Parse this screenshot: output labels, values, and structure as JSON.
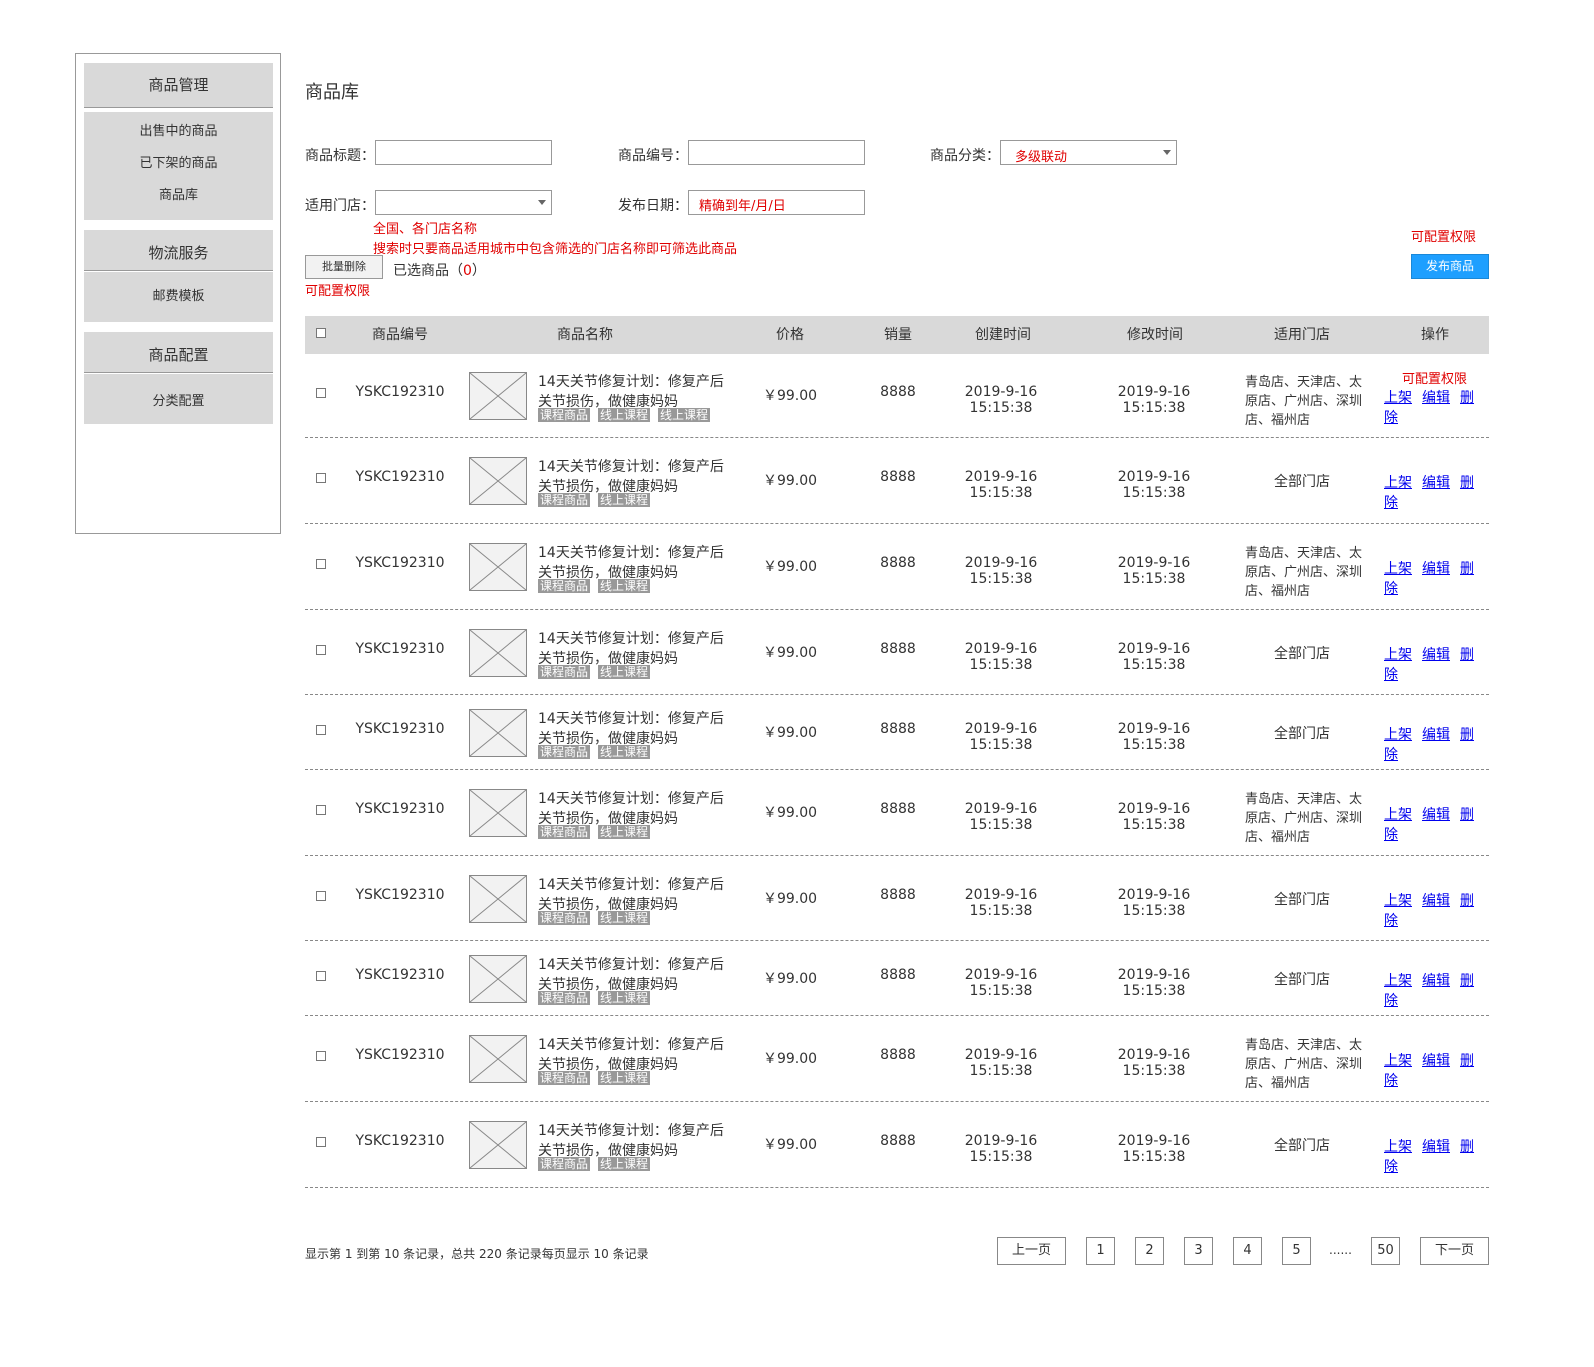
{
  "sidebar": {
    "sections": [
      {
        "title": "商品管理",
        "items": [
          "出售中的商品",
          "已下架的商品",
          "商品库"
        ]
      },
      {
        "title": "物流服务",
        "items": [
          "邮费模板"
        ]
      },
      {
        "title": "商品配置",
        "items": [
          "分类配置"
        ]
      }
    ]
  },
  "page_title": "商品库",
  "filters": {
    "title_label": "商品标题：",
    "code_label": "商品编号：",
    "category_label": "商品分类：",
    "category_value": "多级联动",
    "store_label": "适用门店：",
    "date_label": "发布日期：",
    "date_value": "精确到年/月/日",
    "store_note_1": "全国、各门店名称",
    "store_note_2": "搜索时只要商品适用城市中包含筛选的门店名称即可筛选此商品"
  },
  "actions": {
    "batch_delete": "批量删除",
    "selected_prefix": "已选商品（",
    "selected_count": "0",
    "selected_suffix": "）",
    "perm_note": "可配置权限",
    "publish": "发布商品",
    "publish_perm_note": "可配置权限"
  },
  "table": {
    "headers": [
      "商品编号",
      "商品名称",
      "价格",
      "销量",
      "创建时间",
      "修改时间",
      "适用门店",
      "操作"
    ],
    "ops_perm_note": "可配置权限",
    "rows": [
      {
        "code": "YSKC192310",
        "name1": "14天关节修复计划：修复产后",
        "name2": "关节损伤，做健康妈妈",
        "tags": [
          "课程商品",
          "线上课程",
          "线上课程"
        ],
        "price": "￥99.00",
        "sales": "8888",
        "created": "2019-9-16 15:15:38",
        "modified": "2019-9-16 15:15:38",
        "store": "青岛店、天津店、太原店、广州店、深圳店、福州店",
        "multi": true,
        "ops": [
          "上架",
          "编辑",
          "删除"
        ]
      },
      {
        "code": "YSKC192310",
        "name1": "14天关节修复计划：修复产后",
        "name2": "关节损伤，做健康妈妈",
        "tags": [
          "课程商品",
          "线上课程"
        ],
        "price": "￥99.00",
        "sales": "8888",
        "created": "2019-9-16 15:15:38",
        "modified": "2019-9-16 15:15:38",
        "store": "全部门店",
        "multi": false,
        "ops": [
          "上架",
          "编辑",
          "删除"
        ]
      },
      {
        "code": "YSKC192310",
        "name1": "14天关节修复计划：修复产后",
        "name2": "关节损伤，做健康妈妈",
        "tags": [
          "课程商品",
          "线上课程"
        ],
        "price": "￥99.00",
        "sales": "8888",
        "created": "2019-9-16 15:15:38",
        "modified": "2019-9-16 15:15:38",
        "store": "青岛店、天津店、太原店、广州店、深圳店、福州店",
        "multi": true,
        "ops": [
          "上架",
          "编辑",
          "删除"
        ]
      },
      {
        "code": "YSKC192310",
        "name1": "14天关节修复计划：修复产后",
        "name2": "关节损伤，做健康妈妈",
        "tags": [
          "课程商品",
          "线上课程"
        ],
        "price": "￥99.00",
        "sales": "8888",
        "created": "2019-9-16 15:15:38",
        "modified": "2019-9-16 15:15:38",
        "store": "全部门店",
        "multi": false,
        "ops": [
          "上架",
          "编辑",
          "删除"
        ]
      },
      {
        "code": "YSKC192310",
        "name1": "14天关节修复计划：修复产后",
        "name2": "关节损伤，做健康妈妈",
        "tags": [
          "课程商品",
          "线上课程"
        ],
        "price": "￥99.00",
        "sales": "8888",
        "created": "2019-9-16 15:15:38",
        "modified": "2019-9-16 15:15:38",
        "store": "全部门店",
        "multi": false,
        "ops": [
          "上架",
          "编辑",
          "删除"
        ]
      },
      {
        "code": "YSKC192310",
        "name1": "14天关节修复计划：修复产后",
        "name2": "关节损伤，做健康妈妈",
        "tags": [
          "课程商品",
          "线上课程"
        ],
        "price": "￥99.00",
        "sales": "8888",
        "created": "2019-9-16 15:15:38",
        "modified": "2019-9-16 15:15:38",
        "store": "青岛店、天津店、太原店、广州店、深圳店、福州店",
        "multi": true,
        "ops": [
          "上架",
          "编辑",
          "删除"
        ]
      },
      {
        "code": "YSKC192310",
        "name1": "14天关节修复计划：修复产后",
        "name2": "关节损伤，做健康妈妈",
        "tags": [
          "课程商品",
          "线上课程"
        ],
        "price": "￥99.00",
        "sales": "8888",
        "created": "2019-9-16 15:15:38",
        "modified": "2019-9-16 15:15:38",
        "store": "全部门店",
        "multi": false,
        "ops": [
          "上架",
          "编辑",
          "删除"
        ]
      },
      {
        "code": "YSKC192310",
        "name1": "14天关节修复计划：修复产后",
        "name2": "关节损伤，做健康妈妈",
        "tags": [
          "课程商品",
          "线上课程"
        ],
        "price": "￥99.00",
        "sales": "8888",
        "created": "2019-9-16 15:15:38",
        "modified": "2019-9-16 15:15:38",
        "store": "全部门店",
        "multi": false,
        "ops": [
          "上架",
          "编辑",
          "删除"
        ]
      },
      {
        "code": "YSKC192310",
        "name1": "14天关节修复计划：修复产后",
        "name2": "关节损伤，做健康妈妈",
        "tags": [
          "课程商品",
          "线上课程"
        ],
        "price": "￥99.00",
        "sales": "8888",
        "created": "2019-9-16 15:15:38",
        "modified": "2019-9-16 15:15:38",
        "store": "青岛店、天津店、太原店、广州店、深圳店、福州店",
        "multi": true,
        "ops": [
          "上架",
          "编辑",
          "删除"
        ]
      },
      {
        "code": "YSKC192310",
        "name1": "14天关节修复计划：修复产后",
        "name2": "关节损伤，做健康妈妈",
        "tags": [
          "课程商品",
          "线上课程"
        ],
        "price": "￥99.00",
        "sales": "8888",
        "created": "2019-9-16 15:15:38",
        "modified": "2019-9-16 15:15:38",
        "store": "全部门店",
        "multi": false,
        "ops": [
          "上架",
          "编辑",
          "删除"
        ]
      }
    ]
  },
  "pagination": {
    "summary": "显示第 1 到第 10 条记录，总共 220 条记录每页显示 10  条记录",
    "prev": "上一页",
    "pages": [
      "1",
      "2",
      "3",
      "4",
      "5"
    ],
    "ellipsis": "......",
    "last": "50",
    "next": "下一页"
  }
}
